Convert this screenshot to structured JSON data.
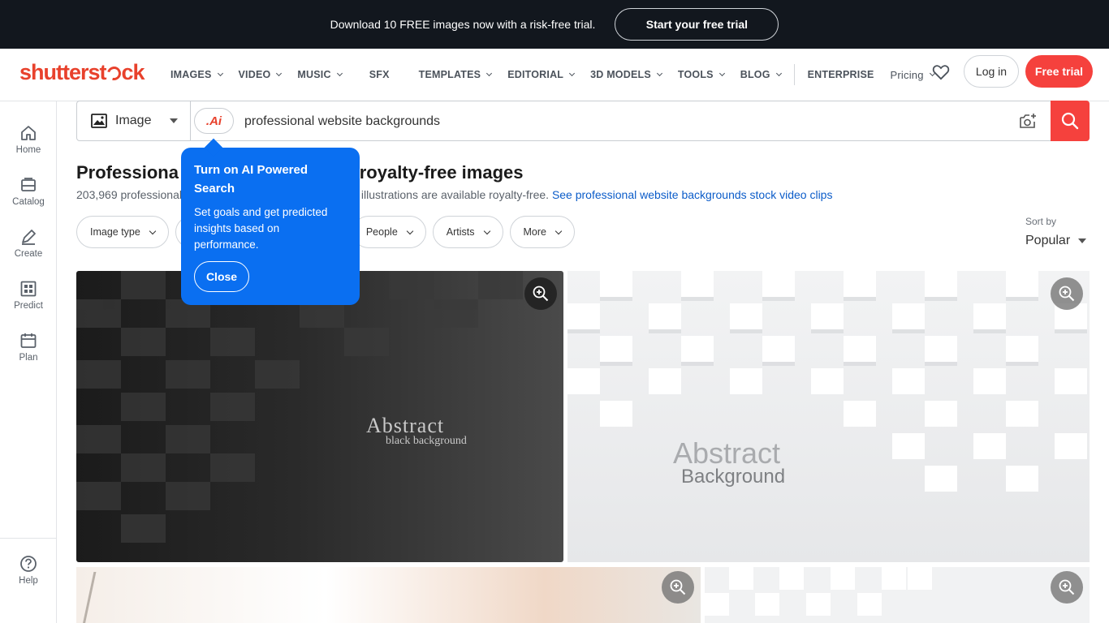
{
  "promo": {
    "text": "Download 10 FREE images now with a risk-free trial.",
    "cta": "Start your free trial"
  },
  "header": {
    "logo": {
      "pre": "shutterst",
      "post": "ck"
    },
    "nav": [
      {
        "label": "IMAGES",
        "chevron": true
      },
      {
        "label": "VIDEO",
        "chevron": true
      },
      {
        "label": "MUSIC",
        "chevron": true
      },
      {
        "label": "SFX",
        "chevron": false
      },
      {
        "label": "TEMPLATES",
        "chevron": true
      },
      {
        "label": "EDITORIAL",
        "chevron": true
      },
      {
        "label": "3D MODELS",
        "chevron": true
      },
      {
        "label": "TOOLS",
        "chevron": true
      },
      {
        "label": "BLOG",
        "chevron": true
      }
    ],
    "enterprise": "ENTERPRISE",
    "pricing": "Pricing",
    "login": "Log in",
    "free_trial": "Free trial"
  },
  "rail": {
    "home": "Home",
    "catalog": "Catalog",
    "create": "Create",
    "predict": "Predict",
    "plan": "Plan",
    "help": "Help"
  },
  "search": {
    "type": "Image",
    "ai_label": ".Ai",
    "query": "professional website backgrounds"
  },
  "results": {
    "title_start": "Professiona",
    "title_end": "ds royalty-free images",
    "subtitle_start": "203,969 professional",
    "subtitle_end": ", vectors, and illustrations are available royalty-free.",
    "video_link": "See professional website backgrounds stock video clips"
  },
  "filters": {
    "image_type": "Image type",
    "people": "People",
    "artists": "Artists",
    "more": "More"
  },
  "sort": {
    "label": "Sort by",
    "value": "Popular"
  },
  "images": {
    "one": {
      "big": "Abstract",
      "small": "black background"
    },
    "two": {
      "big": "Abstract",
      "small": "Background"
    }
  },
  "tooltip": {
    "title": "Turn on AI Powered Search",
    "body": "Set goals and get predicted insights based on performance.",
    "close": "Close"
  },
  "colors": {
    "brand": "#f5413d",
    "tooltip": "#0a6ff1",
    "link": "#0b5cc9",
    "banner": "#12171e"
  }
}
